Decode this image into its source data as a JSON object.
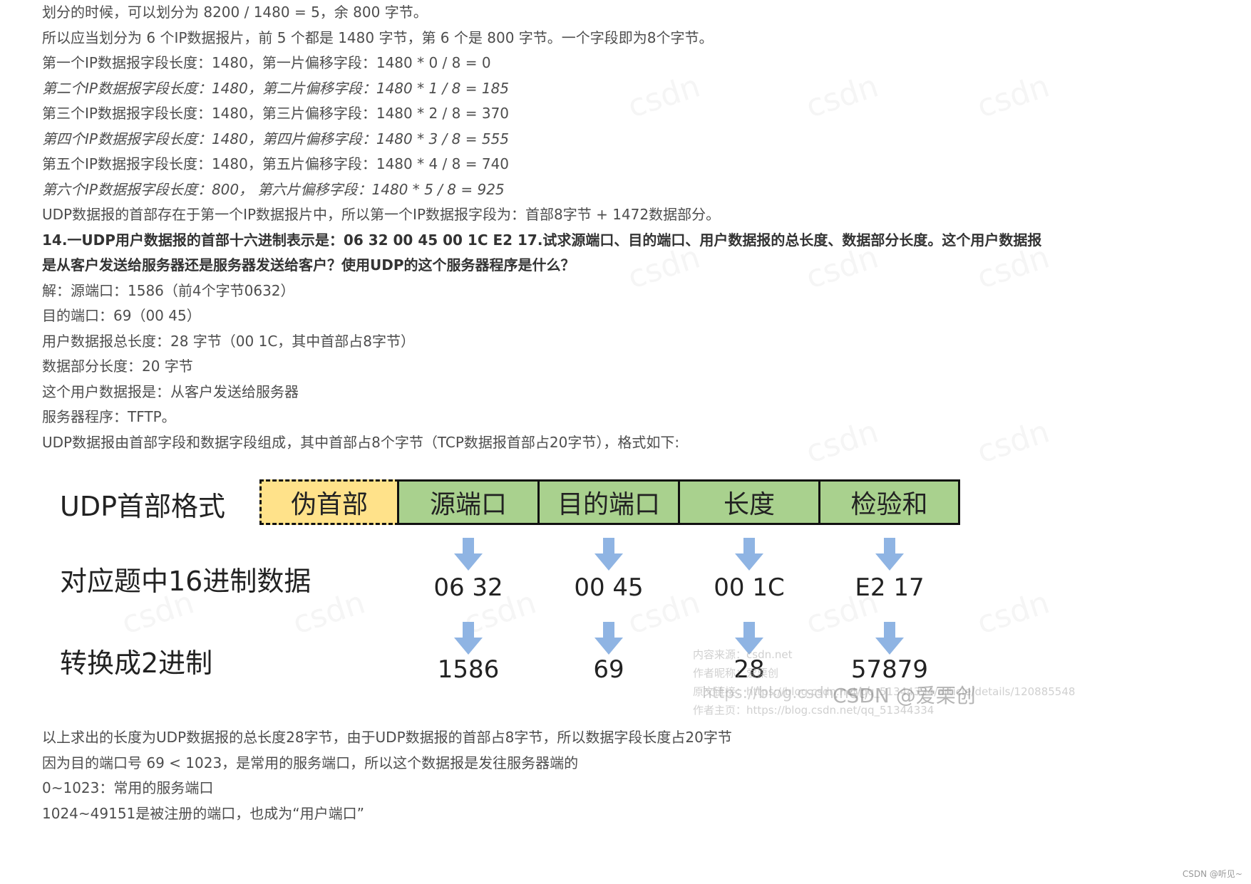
{
  "paragraphs_top": [
    {
      "text": "划分的时候，可以划分为 8200 / 1480 = 5，余 800 字节。",
      "style": "normal"
    },
    {
      "text": "所以应当划分为 6 个IP数据报片，前 5 个都是 1480 字节，第 6 个是 800 字节。一个字段即为8个字节。",
      "style": "normal"
    },
    {
      "text": "第一个IP数据报字段长度：1480，第一片偏移字段：1480 * 0 / 8 = 0",
      "style": "normal"
    },
    {
      "text": "第二个IP数据报字段长度：1480，第二片偏移字段：1480 * 1 / 8 = 185",
      "style": "italic"
    },
    {
      "text": "第三个IP数据报字段长度：1480，第三片偏移字段：1480 * 2 / 8 = 370",
      "style": "normal"
    },
    {
      "text": "第四个IP数据报字段长度：1480，第四片偏移字段：1480 * 3 / 8 = 555",
      "style": "italic"
    },
    {
      "text": "第五个IP数据报字段长度：1480，第五片偏移字段：1480 * 4 / 8 = 740",
      "style": "normal"
    },
    {
      "text": "第六个IP数据报字段长度：800， 第六片偏移字段：1480 * 5 / 8 = 925",
      "style": "italic"
    },
    {
      "text": "UDP数据报的首部存在于第一个IP数据报片中，所以第一个IP数据报字段为：首部8字节 + 1472数据部分。",
      "style": "normal"
    },
    {
      "text": "14.一UDP用户数据报的首部十六进制表示是：06 32 00 45 00 1C E2 17.试求源端口、目的端口、用户数据报的总长度、数据部分长度。这个用户数据报",
      "style": "bold"
    },
    {
      "text": "是从客户发送给服务器还是服务器发送给客户？使用UDP的这个服务器程序是什么？",
      "style": "bold"
    },
    {
      "text": "解：源端口：1586（前4个字节0632）",
      "style": "normal"
    },
    {
      "text": "目的端口：69（00 45）",
      "style": "normal"
    },
    {
      "text": "用户数据报总长度：28 字节（00 1C，其中首部占8字节）",
      "style": "normal"
    },
    {
      "text": "数据部分长度：20 字节",
      "style": "normal"
    },
    {
      "text": "这个用户数据报是：从客户发送给服务器",
      "style": "normal"
    },
    {
      "text": "服务器程序：TFTP。",
      "style": "normal"
    },
    {
      "text": "UDP数据报由首部字段和数据字段组成，其中首部占8个字节（TCP数据报首部占20字节），格式如下:",
      "style": "normal"
    }
  ],
  "diagram": {
    "row_labels": [
      "UDP首部格式",
      "对应题中16进制数据",
      "转换成2进制"
    ],
    "pseudo_header": "伪首部",
    "fields": [
      "源端口",
      "目的端口",
      "长度",
      "检验和"
    ],
    "hex_values": [
      "06 32",
      "00 45",
      "00 1C",
      "E2 17"
    ],
    "dec_values": [
      "1586",
      "69",
      "28",
      "57879"
    ],
    "colors": {
      "field_fill": "#a9d18e",
      "pseudo_fill": "#ffe28a",
      "arrow": "#8fb4e3"
    }
  },
  "watermark_overlay": {
    "source_line": "内容来源：csdn.net",
    "author_line": "作者昵称：爱栗创",
    "link_line": "原文链接：https://blog.csdn.net/qq_51344334/article/details/120885548",
    "home_line": "作者主页：https://blog.csdn.net/qq_51344334",
    "url_line": "https://blog.csdn.net/",
    "csdn_mark": "CSDN @爱栗创"
  },
  "paragraphs_bottom": [
    {
      "text": "以上求出的长度为UDP数据报的总长度28字节，由于UDP数据报的首部占8字节，所以数据字段长度占20字节",
      "style": "normal"
    },
    {
      "text": "因为目的端口号 69 < 1023，是常用的服务端口，所以这个数据报是发往服务器端的",
      "style": "normal"
    },
    {
      "text": "0~1023：常用的服务端口",
      "style": "normal"
    },
    {
      "text": "1024~49151是被注册的端口，也成为“用户端口”",
      "style": "normal"
    }
  ],
  "footer": "CSDN @听见~"
}
